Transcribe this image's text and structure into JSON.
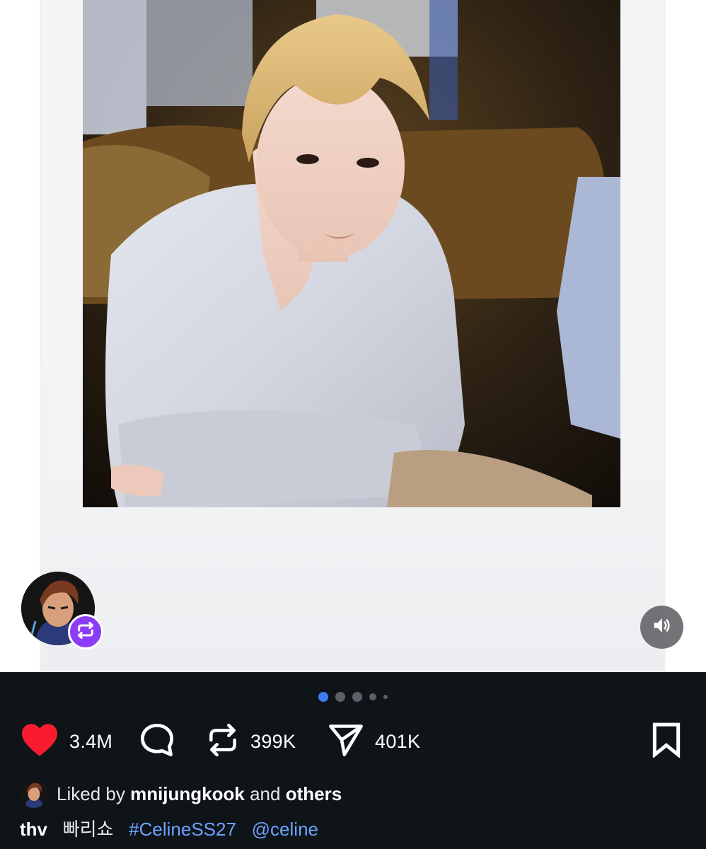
{
  "post": {
    "carousel": {
      "total": 5,
      "active_index": 0
    },
    "media_alt": "photo-post",
    "reposted_by_icon": "repost-icon",
    "sound_icon": "speaker-icon"
  },
  "actions": {
    "like": {
      "icon": "heart-icon",
      "count": "3.4M",
      "color": "#f91c2e"
    },
    "comment": {
      "icon": "comment-bubble-icon"
    },
    "repost": {
      "icon": "repost-icon",
      "count": "399K"
    },
    "share": {
      "icon": "send-icon",
      "count": "401K"
    },
    "bookmark": {
      "icon": "bookmark-icon"
    }
  },
  "liked_by": {
    "prefix": "Liked by",
    "user": "mnijungkook",
    "conjunction": "and",
    "others": "others"
  },
  "caption": {
    "username": "thv",
    "text": "빠리쇼",
    "hashtag": "#CelineSS27",
    "mention": "@celine"
  },
  "colors": {
    "bar_background": "#0f1419",
    "accent_link": "#6fa2ff",
    "active_dot": "#3d7cf0",
    "repost_badge": "#8b3cf7"
  }
}
